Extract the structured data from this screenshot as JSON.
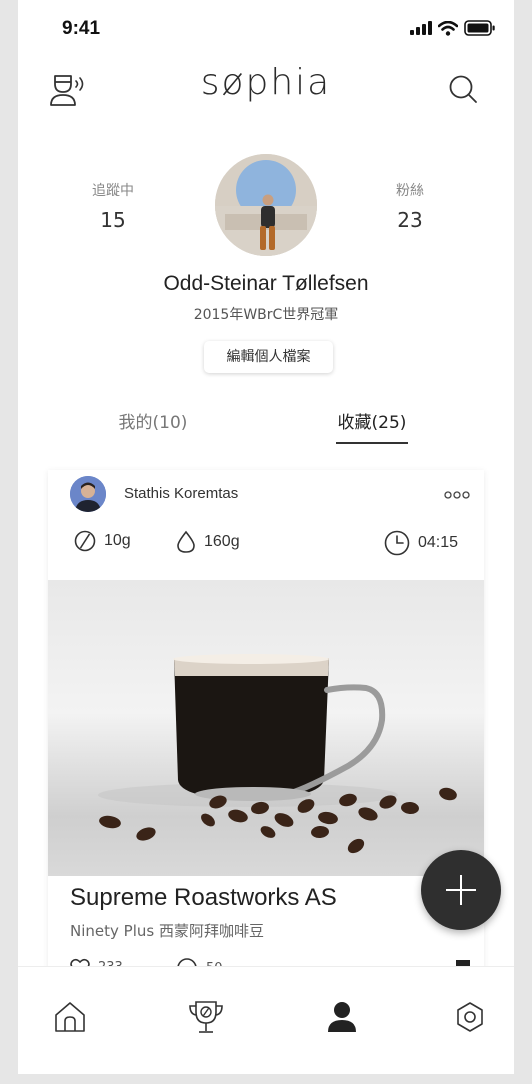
{
  "status_bar": {
    "time": "9:41"
  },
  "header": {
    "logo": "søphia",
    "left_icon": "user-voice-icon",
    "right_icon": "search-icon"
  },
  "profile": {
    "following_label": "追蹤中",
    "following_count": "15",
    "followers_label": "粉絲",
    "followers_count": "23",
    "name": "Odd-Steinar Tøllefsen",
    "subtitle": "2015年WBrC世界冠軍",
    "edit_button": "編輯個人檔案"
  },
  "tabs": [
    {
      "label": "我的(10)",
      "active": false
    },
    {
      "label": "收藏(25)",
      "active": true
    }
  ],
  "card": {
    "user_name": "Stathis Koremtas",
    "more_label": "ooo",
    "coffee_weight": "10g",
    "water_weight": "160g",
    "brew_time": "04:15",
    "title": "Supreme Roastworks AS",
    "subtitle": "Ninety Plus 西蒙阿拜咖啡豆",
    "likes": "233",
    "comments": "50"
  },
  "fab": {
    "icon": "plus-icon"
  },
  "bottom_nav": [
    {
      "icon": "home-icon"
    },
    {
      "icon": "trophy-icon"
    },
    {
      "icon": "profile-icon",
      "active": true
    },
    {
      "icon": "settings-icon"
    }
  ],
  "colors": {
    "accent": "#2f2f2f",
    "background": "#ffffff",
    "muted": "#888888"
  }
}
